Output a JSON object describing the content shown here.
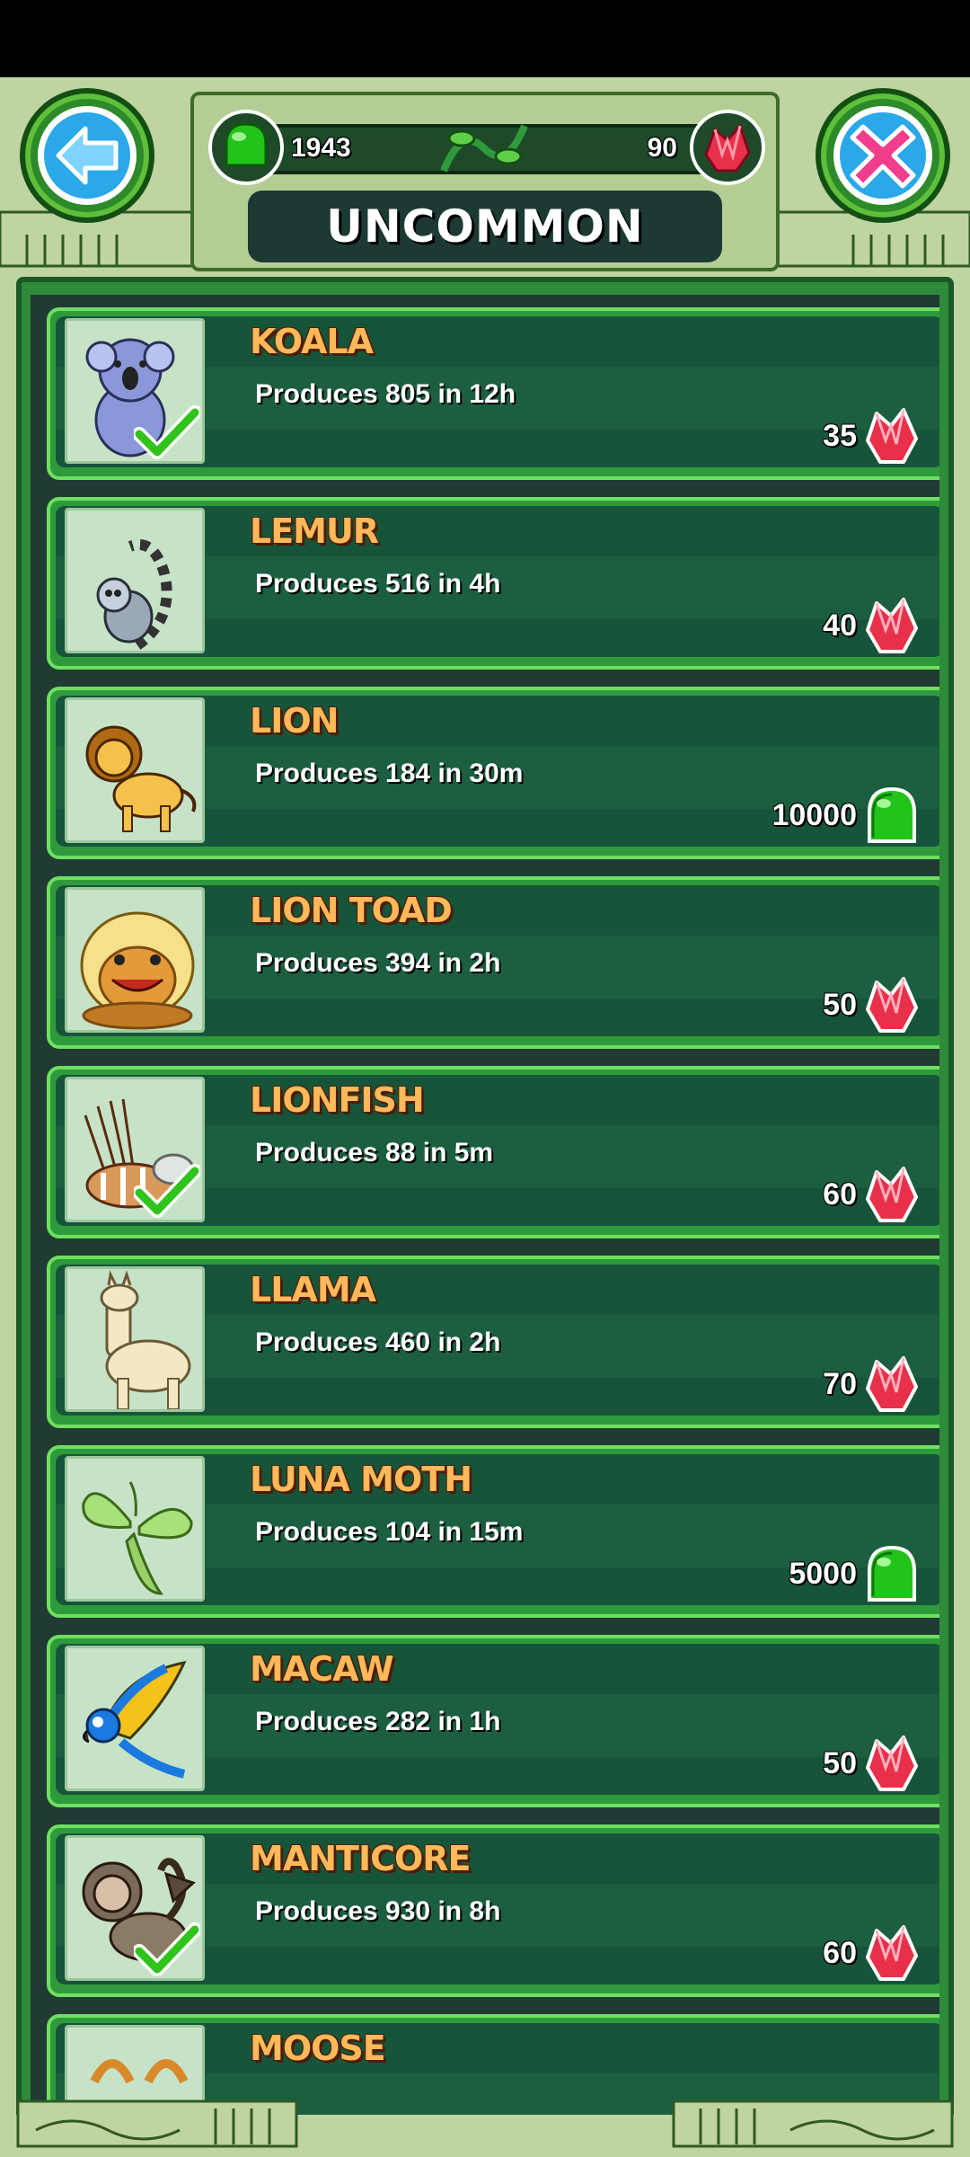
{
  "header": {
    "gum_count": "1943",
    "gem_count": "90",
    "category_title": "UNCOMMON"
  },
  "colors": {
    "row_name": "#ffb85a",
    "row_border": "#6ee060",
    "gem": "#e8304a",
    "gum": "#22c41a"
  },
  "items": [
    {
      "name": "KOALA",
      "desc": "Produces 805 in 12h",
      "price": "35",
      "currency": "gem",
      "owned": true,
      "icon": "koala-icon"
    },
    {
      "name": "LEMUR",
      "desc": "Produces 516 in 4h",
      "price": "40",
      "currency": "gem",
      "owned": false,
      "icon": "lemur-icon"
    },
    {
      "name": "LION",
      "desc": "Produces 184 in 30m",
      "price": "10000",
      "currency": "gum",
      "owned": false,
      "icon": "lion-icon"
    },
    {
      "name": "LION TOAD",
      "desc": "Produces 394 in 2h",
      "price": "50",
      "currency": "gem",
      "owned": false,
      "icon": "lion-toad-icon"
    },
    {
      "name": "LIONFISH",
      "desc": "Produces 88 in 5m",
      "price": "60",
      "currency": "gem",
      "owned": true,
      "icon": "lionfish-icon"
    },
    {
      "name": "LLAMA",
      "desc": "Produces 460 in 2h",
      "price": "70",
      "currency": "gem",
      "owned": false,
      "icon": "llama-icon"
    },
    {
      "name": "LUNA MOTH",
      "desc": "Produces 104 in 15m",
      "price": "5000",
      "currency": "gum",
      "owned": false,
      "icon": "luna-moth-icon"
    },
    {
      "name": "MACAW",
      "desc": "Produces 282 in 1h",
      "price": "50",
      "currency": "gem",
      "owned": false,
      "icon": "macaw-icon"
    },
    {
      "name": "MANTICORE",
      "desc": "Produces 930 in 8h",
      "price": "60",
      "currency": "gem",
      "owned": true,
      "icon": "manticore-icon"
    },
    {
      "name": "MOOSE",
      "desc": "",
      "price": "",
      "currency": "",
      "owned": false,
      "icon": "moose-icon"
    }
  ]
}
